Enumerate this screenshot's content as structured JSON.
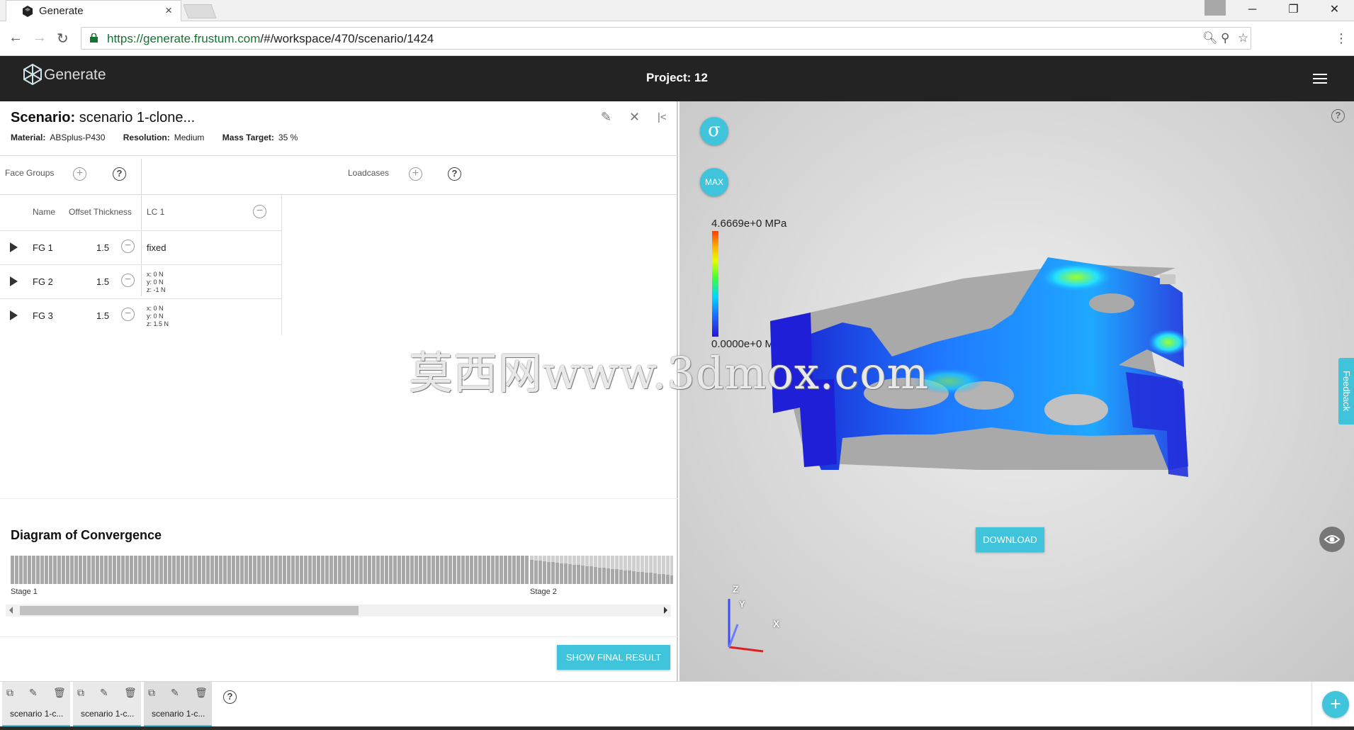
{
  "browser": {
    "tab_title": "Generate",
    "url_host": "https://generate.frustum.com",
    "url_path": "/#/workspace/470/scenario/1424"
  },
  "app": {
    "logo_text": "Generate",
    "project_label": "Project: 12"
  },
  "scenario": {
    "title_label": "Scenario:",
    "title_value": "scenario 1-clone...",
    "material_label": "Material:",
    "material_value": "ABSplus-P430",
    "resolution_label": "Resolution:",
    "resolution_value": "Medium",
    "mass_label": "Mass Target:",
    "mass_value": "35 %"
  },
  "sections": {
    "face_groups": "Face Groups",
    "loadcases": "Loadcases"
  },
  "table": {
    "headers": {
      "name": "Name",
      "offset": "Offset Thickness",
      "lc": "LC 1"
    },
    "rows": [
      {
        "name": "FG 1",
        "thickness": "1.5",
        "lc": "fixed",
        "vec": [
          "",
          "",
          ""
        ]
      },
      {
        "name": "FG 2",
        "thickness": "1.5",
        "lc": "",
        "vec": [
          "x: 0 N",
          "y: 0 N",
          "z: -1 N"
        ]
      },
      {
        "name": "FG 3",
        "thickness": "1.5",
        "lc": "",
        "vec": [
          "x: 0 N",
          "y: 0 N",
          "z: 1.5 N"
        ]
      }
    ]
  },
  "convergence": {
    "title": "Diagram of Convergence",
    "stage1": "Stage 1",
    "stage2": "Stage 2",
    "show_final": "SHOW FINAL RESULT"
  },
  "viewport": {
    "sigma": "σ",
    "max": "MAX",
    "legend_max": "4.6669e+0 MPa",
    "legend_min": "0.0000e+0 MPa",
    "feedback": "Feedback",
    "download": "DOWNLOAD",
    "axis_z": "Z",
    "axis_y": "Y",
    "axis_x": "X"
  },
  "watermark": "莫西网www.3dmox.com",
  "scenario_cards": [
    {
      "label": "scenario 1-c..."
    },
    {
      "label": "scenario 1-c..."
    },
    {
      "label": "scenario 1-c..."
    }
  ],
  "colors": {
    "accent": "#3fc4dc",
    "header": "#232323"
  }
}
